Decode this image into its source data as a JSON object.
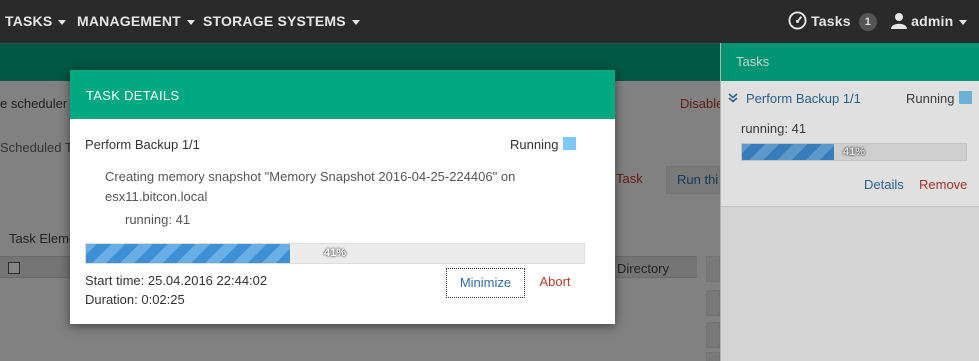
{
  "navbar": {
    "items": [
      {
        "label": "TASKS"
      },
      {
        "label": "MANAGEMENT"
      },
      {
        "label": "STORAGE SYSTEMS"
      }
    ],
    "tasks_label": "Tasks",
    "tasks_count": "1",
    "user": "admin"
  },
  "background": {
    "scheduler_text": "e scheduler is",
    "disable_link": "Disable",
    "scheduled_tab": "Scheduled Ta",
    "task_button": "Task",
    "run_button": "Run thi",
    "task_elements_label": "Task Eleme",
    "directory_header": "Directory"
  },
  "tasks_panel": {
    "title": "Tasks",
    "task_name": "Perform Backup 1/1",
    "status": "Running",
    "progress_text": "running: 41",
    "progress_percent": 41,
    "progress_label": "41%",
    "details_link": "Details",
    "remove_link": "Remove"
  },
  "modal": {
    "title": "TASK DETAILS",
    "task_name": "Perform Backup 1/1",
    "status": "Running",
    "description": "Creating memory snapshot \"Memory Snapshot 2016-04-25-224406\" on esx11.bitcon.local",
    "progress_text": "running: 41",
    "progress_percent": 41,
    "progress_label": "41%",
    "start_time": "Start time: 25.04.2016 22:44:02",
    "duration": "Duration: 0:02:25",
    "minimize_label": "Minimize",
    "abort_label": "Abort"
  },
  "colors": {
    "brand_green": "#01a982",
    "status_running": "#7ec8f4",
    "progress_blue": "#3f8fd4",
    "danger_red": "#c0392b"
  }
}
